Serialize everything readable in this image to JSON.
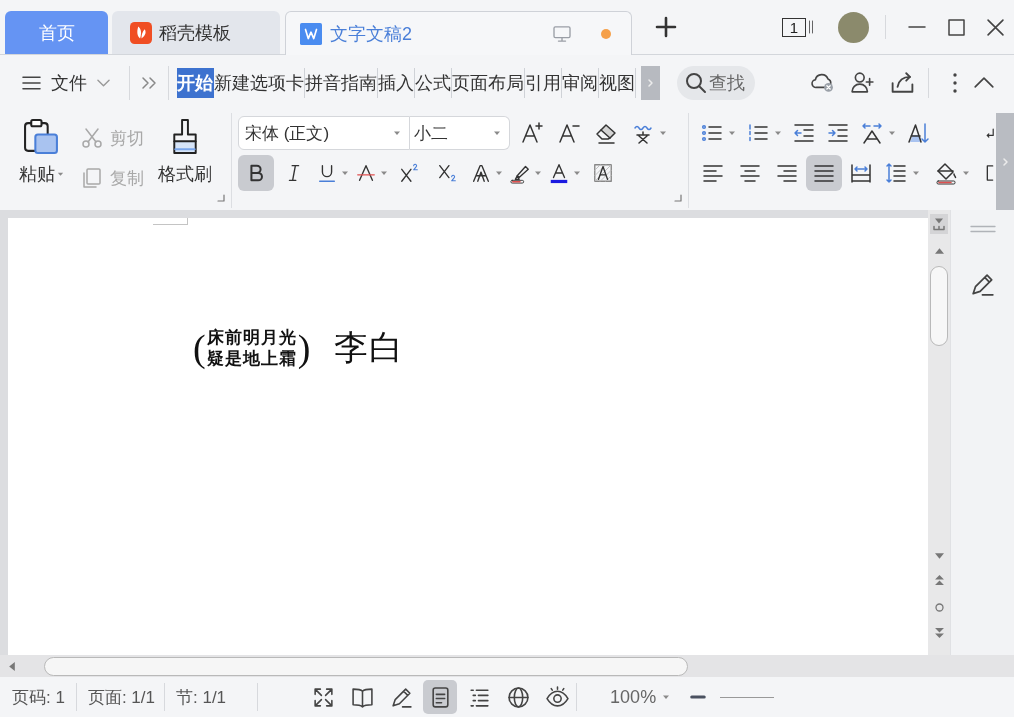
{
  "tabs": [
    {
      "label": "首页",
      "kind": "home",
      "selected": false
    },
    {
      "label": "稻壳模板",
      "kind": "docer",
      "selected": false
    },
    {
      "label": "文字文稿2",
      "kind": "document",
      "selected": true,
      "unsaved": true
    }
  ],
  "window_count": "1",
  "menu": {
    "file": "文件",
    "ribbon_tabs": [
      {
        "label": "开始",
        "selected": true
      },
      {
        "label": "新建选项卡",
        "selected": false
      },
      {
        "label": "拼音指南",
        "selected": false
      },
      {
        "label": "插入",
        "selected": false
      },
      {
        "label": "公式",
        "selected": false
      },
      {
        "label": "页面布局",
        "selected": false
      },
      {
        "label": "引用",
        "selected": false
      },
      {
        "label": "审阅",
        "selected": false
      },
      {
        "label": "视图",
        "selected": false
      }
    ],
    "search": "查找"
  },
  "clipboard": {
    "paste": "粘贴",
    "cut": {
      "label": "剪切",
      "disabled": true
    },
    "copy": {
      "label": "复制",
      "disabled": true
    },
    "format_painter": "格式刷"
  },
  "font": {
    "name": "宋体 (正文)",
    "size": "小二",
    "styles": [
      {
        "kind": "bold",
        "selected": true
      },
      {
        "kind": "italic",
        "selected": false
      },
      {
        "kind": "underline",
        "selected": false
      },
      {
        "kind": "strikethrough",
        "selected": false
      },
      {
        "kind": "superscript",
        "selected": false
      },
      {
        "kind": "subscript",
        "selected": false
      }
    ]
  },
  "paragraph": {
    "alignments": [
      {
        "kind": "left",
        "selected": false
      },
      {
        "kind": "center",
        "selected": false
      },
      {
        "kind": "right",
        "selected": false
      },
      {
        "kind": "justify",
        "selected": true
      },
      {
        "kind": "distributed",
        "selected": false
      }
    ]
  },
  "document": {
    "combined_text": {
      "open": "(",
      "lines": [
        "床前明月光",
        "疑是地上霜"
      ],
      "close": ")"
    },
    "author": "李白"
  },
  "status_bar": {
    "page_number": "页码: 1",
    "pages": "页面: 1/1",
    "section": "节: 1/1",
    "views": [
      {
        "kind": "fullscreen",
        "selected": false
      },
      {
        "kind": "reading",
        "selected": false
      },
      {
        "kind": "revise",
        "selected": false
      },
      {
        "kind": "page",
        "selected": true
      },
      {
        "kind": "outline",
        "selected": false
      },
      {
        "kind": "web",
        "selected": false
      },
      {
        "kind": "eye_care",
        "selected": false
      }
    ],
    "zoom": "100%"
  }
}
